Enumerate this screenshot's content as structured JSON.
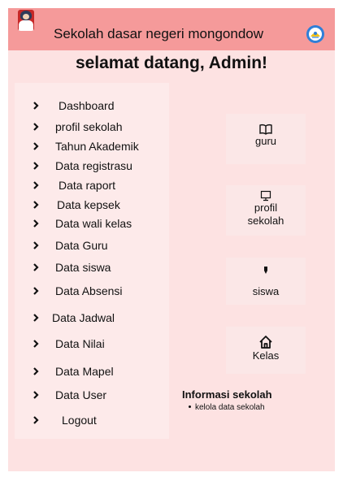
{
  "header": {
    "school_name": "Sekolah dasar negeri mongondow",
    "avatar": "user-avatar",
    "logo": "tut-wuri-handayani-logo"
  },
  "welcome": "selamat datang, Admin!",
  "sidebar": {
    "items": [
      {
        "label": "Dashboard"
      },
      {
        "label": "profil sekolah"
      },
      {
        "label": "Tahun Akademik"
      },
      {
        "label": "Data registrasu"
      },
      {
        "label": "Data raport"
      },
      {
        "label": "Data kepsek"
      },
      {
        "label": "Data wali kelas"
      },
      {
        "label": "Data Guru"
      },
      {
        "label": "Data siswa"
      },
      {
        "label": "Data Absensi"
      },
      {
        "label": "Data Jadwal"
      },
      {
        "label": "Data Nilai"
      },
      {
        "label": "Data Mapel"
      },
      {
        "label": "Data User"
      },
      {
        "label": "Logout"
      }
    ]
  },
  "cards": [
    {
      "label": "guru",
      "icon": "book-icon"
    },
    {
      "label": "profil sekolah",
      "icon": "monitor-icon"
    },
    {
      "label": "siswa",
      "icon": "pen-icon"
    },
    {
      "label": "Kelas",
      "icon": "home-icon"
    }
  ],
  "info": {
    "title": "Informasi sekolah",
    "items": [
      "kelola data sekolah"
    ]
  },
  "colors": {
    "header_bg": "#f59a9a",
    "page_bg": "#fde2e2",
    "sidebar_bg": "#fdeaea",
    "card_bg": "#fbe7e7"
  }
}
